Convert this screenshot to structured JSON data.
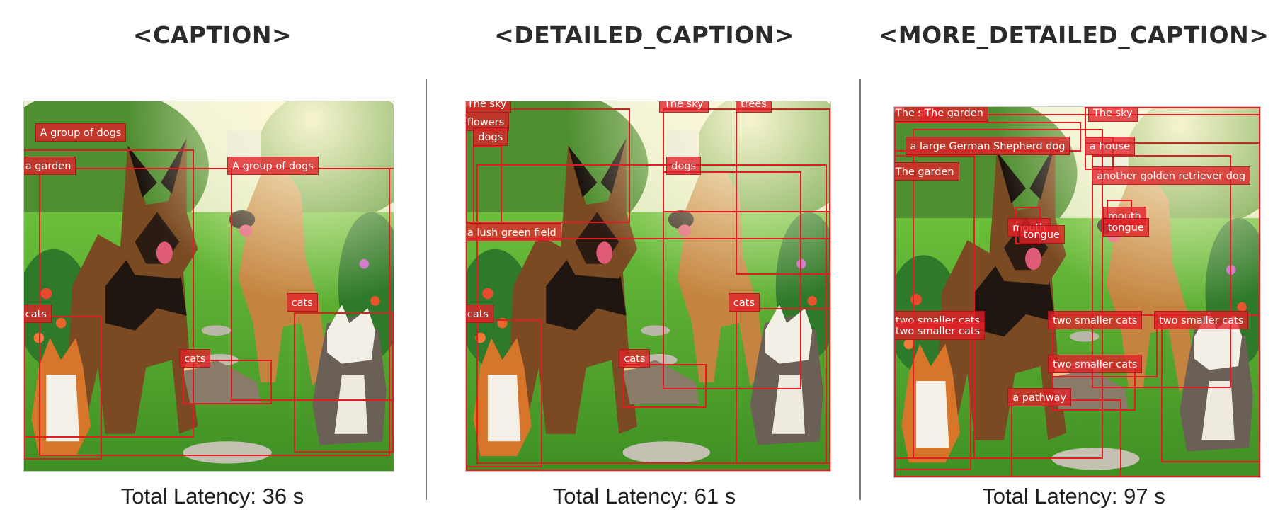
{
  "panels": [
    {
      "title": "<CAPTION>",
      "latency": "Total Latency: 36 s",
      "labels": [
        "A group of dogs",
        "a garden",
        "A group of dogs",
        "cats",
        "cats",
        "cats"
      ]
    },
    {
      "title": "<DETAILED_CAPTION>",
      "latency": "Total Latency: 61 s",
      "labels": [
        "The sky",
        "flowers",
        "dogs",
        "The sky",
        "trees",
        "dogs",
        "a lush green field",
        "cats",
        "cats",
        "cats"
      ]
    },
    {
      "title": "<MORE_DETAILED_CAPTION>",
      "latency": "Total Latency: 97 s",
      "labels": [
        "The sky",
        "The garden",
        "The sky",
        "a large German Shepherd dog",
        "a house",
        "The garden",
        "another golden retriever dog",
        "mouth",
        "tongue",
        "mouth",
        "tongue",
        "two smaller cats",
        "two smaller cats",
        "two smaller cats",
        "two smaller cats",
        "two smaller cats",
        "a pathway"
      ]
    }
  ],
  "colors": {
    "box": "#e31b23",
    "label_bg": "#e22028",
    "label_text": "#ffffff",
    "divider": "#7a7a7a"
  },
  "icons": [
    "photo-scene-dogs-cats-garden"
  ]
}
